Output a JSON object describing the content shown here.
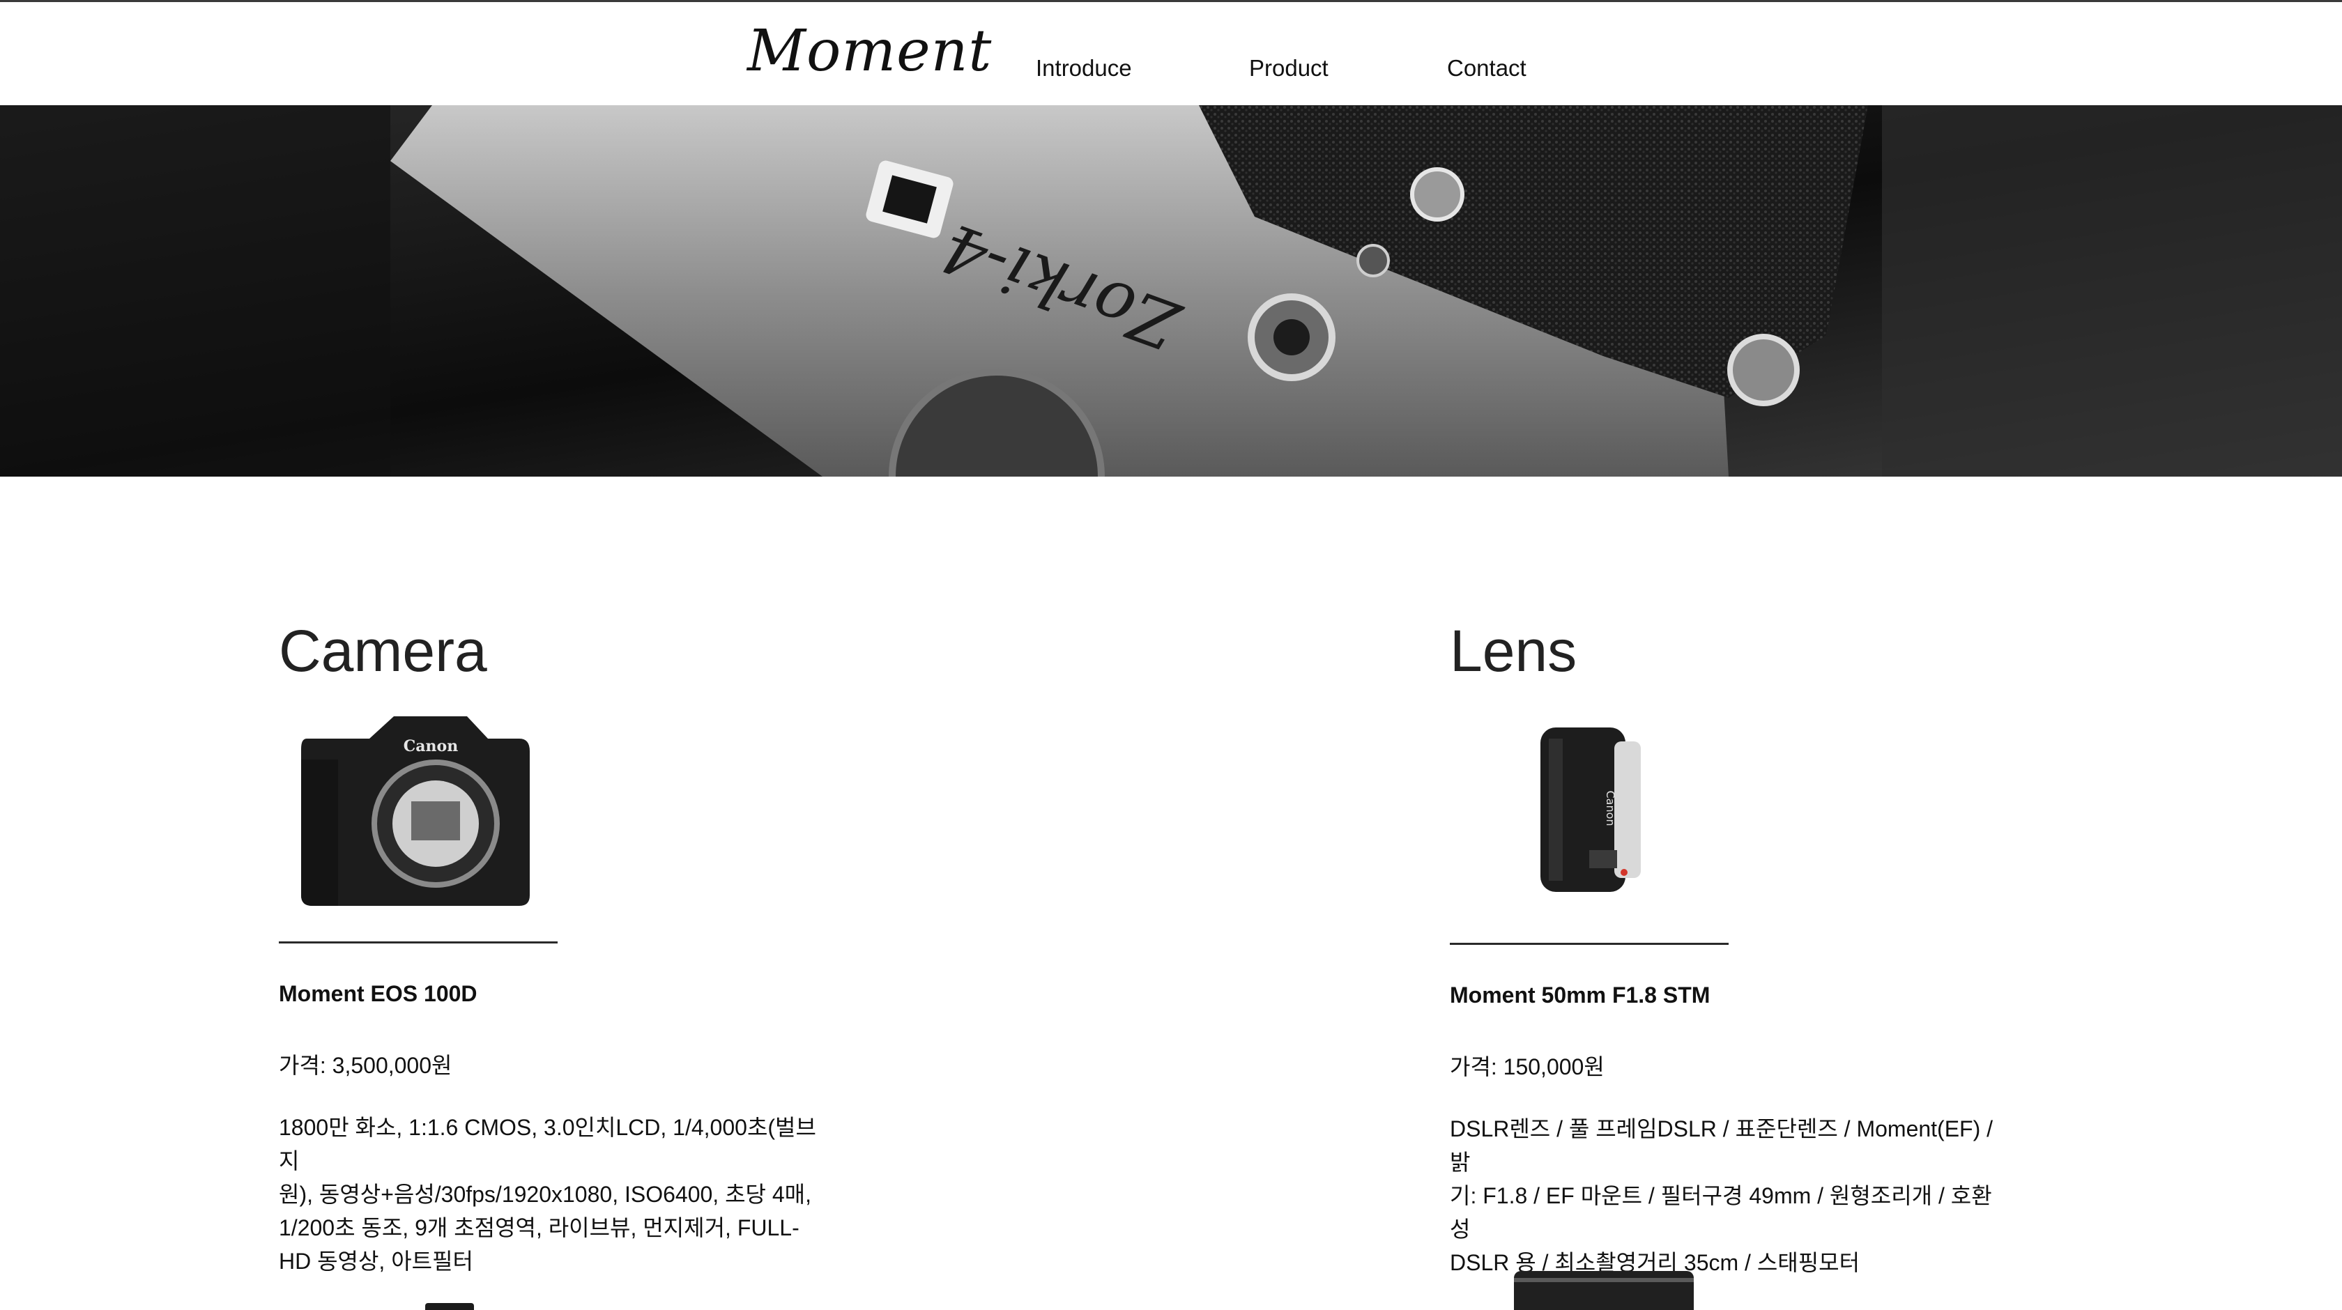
{
  "header": {
    "logo": "Moment",
    "nav": [
      "Introduce",
      "Product",
      "Contact"
    ]
  },
  "hero": {
    "camera_script": "Zorki-4"
  },
  "sections": [
    {
      "title": "Camera",
      "image_brand": "Canon",
      "product_name": "Moment EOS 100D",
      "price": "가격: 3,500,000원",
      "description": "1800만 화소, 1:1.6 CMOS, 3.0인치LCD, 1/4,000초(벌브지\n원), 동영상+음성/30fps/1920x1080, ISO6400, 초당 4매,\n1/200초 동조, 9개 초점영역, 라이브뷰, 먼지제거, FULL-\nHD 동영상, 아트필터"
    },
    {
      "title": "Lens",
      "image_brand": "Canon",
      "product_name": "Moment 50mm F1.8 STM",
      "price": "가격: 150,000원",
      "description": "DSLR렌즈 / 풀 프레임DSLR / 표준단렌즈 / Moment(EF) / 밝\n기: F1.8 / EF 마운트 / 필터구경 49mm /  원형조리개 / 호환성\nDSLR 용 / 최소촬영거리 35cm / 스태핑모터"
    }
  ]
}
